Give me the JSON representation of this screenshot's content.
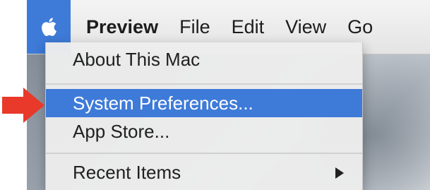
{
  "colors": {
    "accent": "#3e7ad8",
    "pointer_arrow": "#e8392a",
    "menu_background": "#ececec",
    "menu_text": "#202020"
  },
  "menubar": {
    "apple_icon": "apple-icon",
    "items": [
      {
        "label": "Preview"
      },
      {
        "label": "File"
      },
      {
        "label": "Edit"
      },
      {
        "label": "View"
      },
      {
        "label": "Go"
      }
    ]
  },
  "apple_menu": {
    "items": [
      {
        "label": "About This Mac"
      },
      {
        "label": "System Preferences...",
        "selected": true
      },
      {
        "label": "App Store..."
      },
      {
        "label": "Recent Items",
        "submenu": true
      }
    ]
  },
  "annotation": {
    "icon": "red-pointer-arrow-icon"
  }
}
